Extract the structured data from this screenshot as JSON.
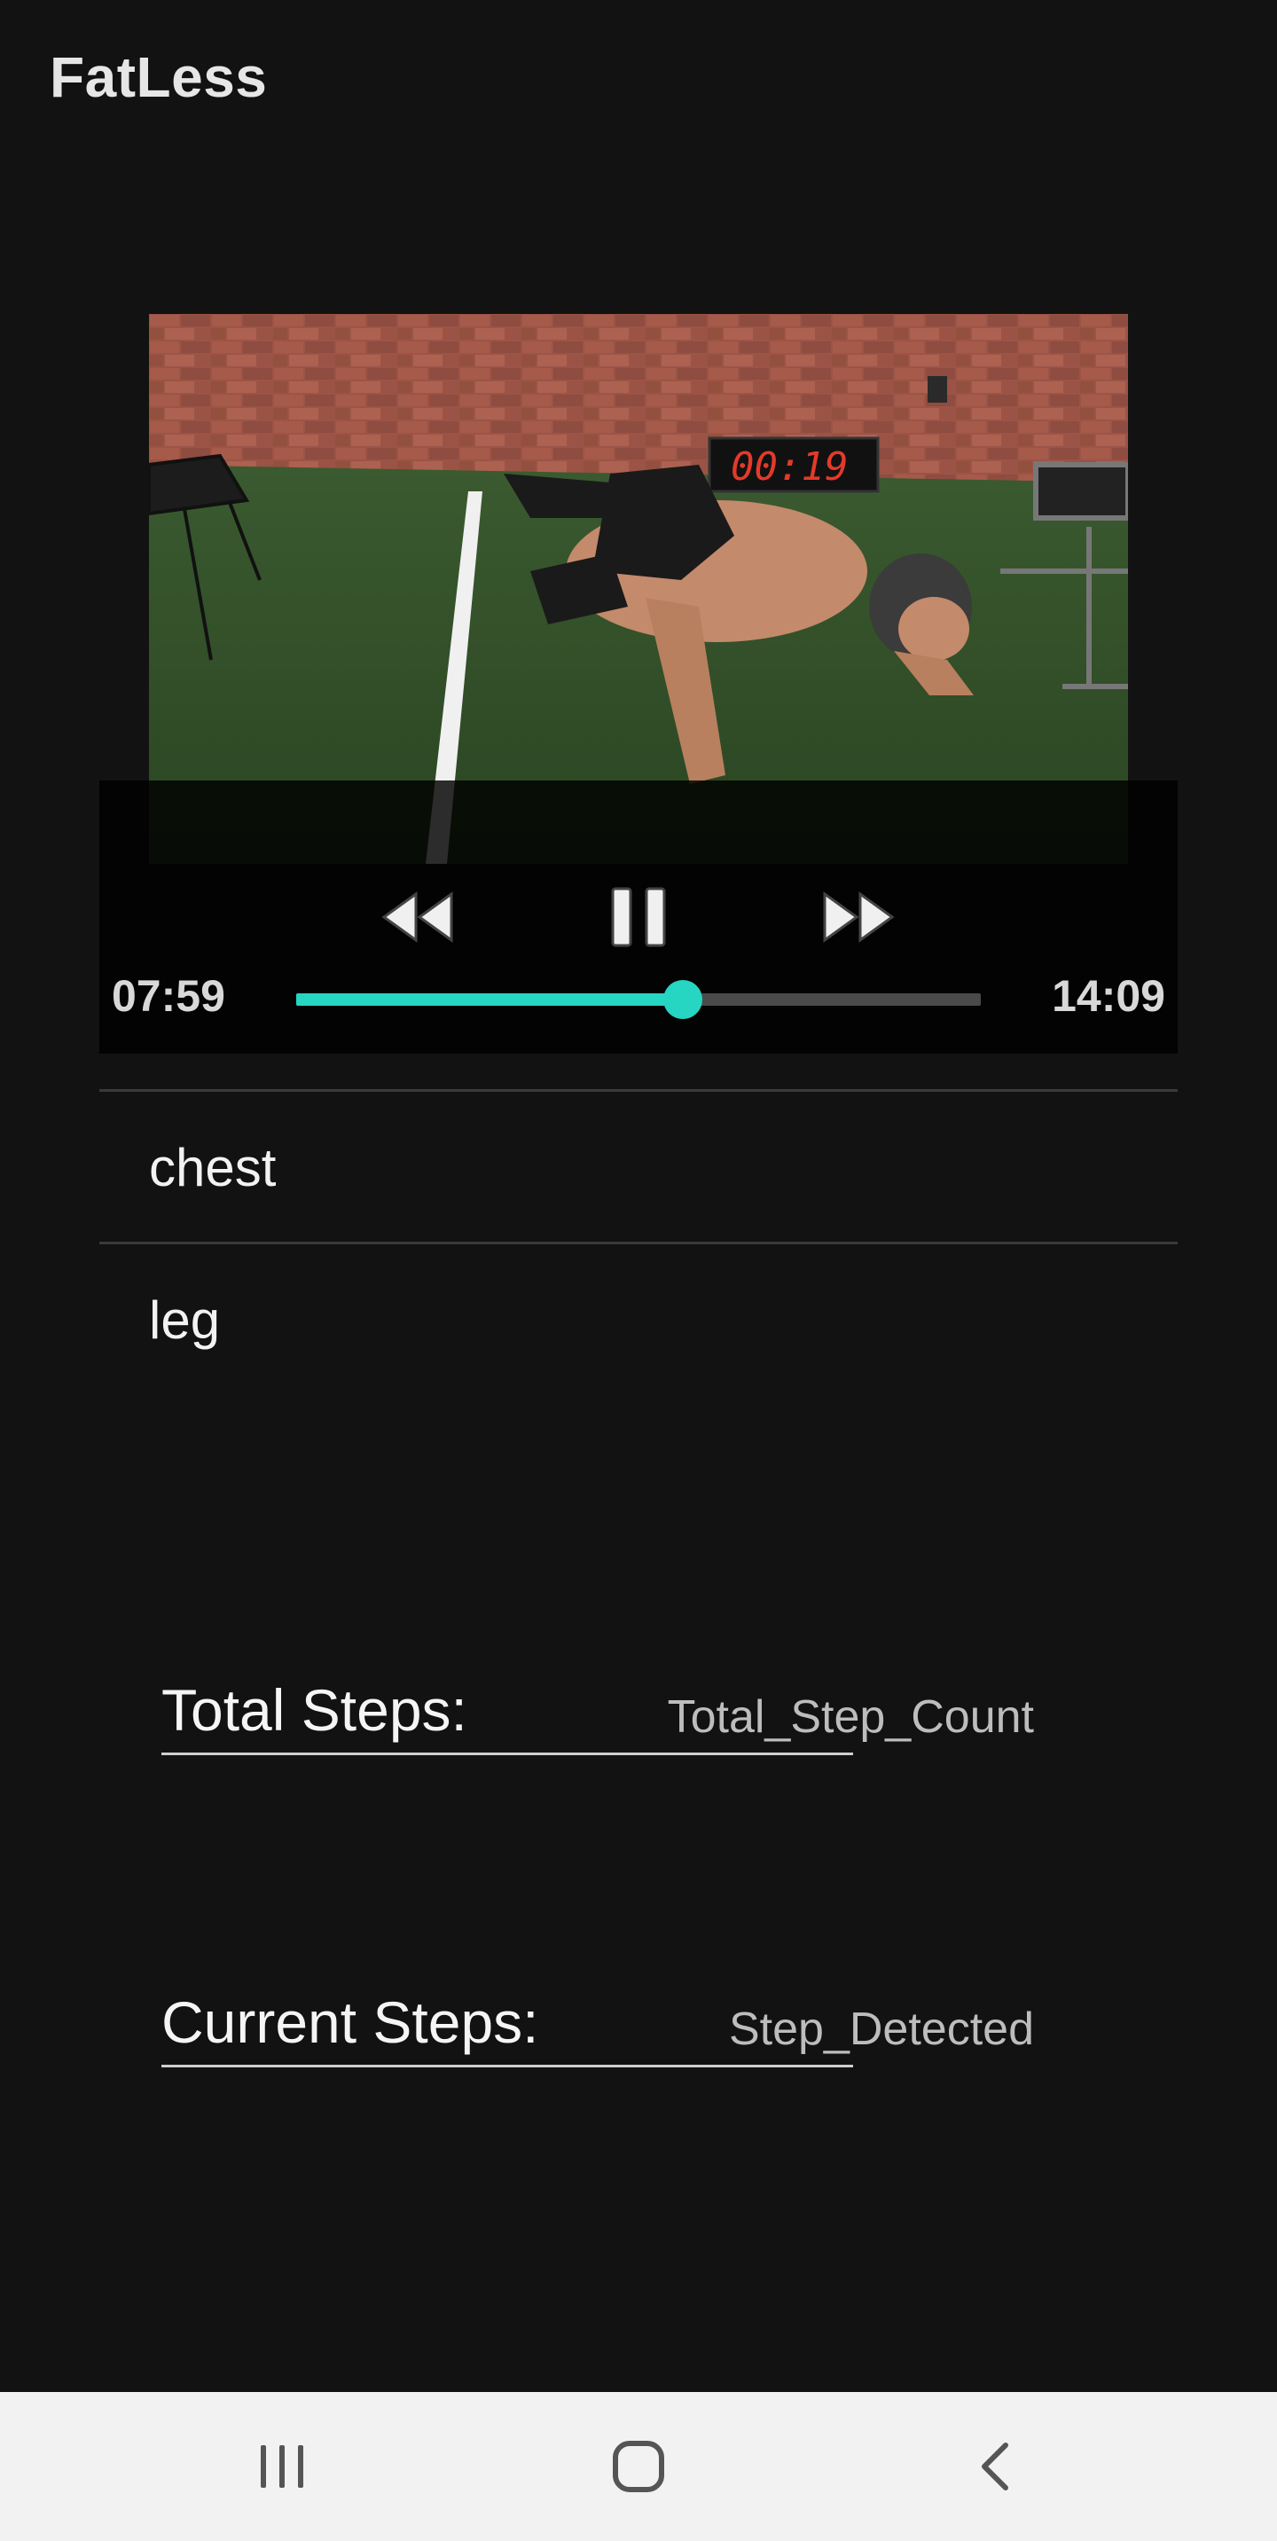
{
  "app": {
    "title": "FatLess"
  },
  "video": {
    "scene": "workout-video-frame",
    "timer_display": "00:19",
    "controls": {
      "rewind_icon": "rewind-icon",
      "pause_icon": "pause-icon",
      "fast_forward_icon": "fast-forward-icon"
    },
    "current_time": "07:59",
    "total_time": "14:09",
    "progress": 0.565,
    "accent_color": "#26d6c2"
  },
  "list": {
    "items": [
      {
        "label": "chest"
      },
      {
        "label": "leg"
      }
    ]
  },
  "steps": {
    "total_label": "Total Steps:",
    "total_value": "Total_Step_Count",
    "current_label": "Current Steps:",
    "current_value": "Step_Detected"
  },
  "nav": {
    "recents_icon": "recents-icon",
    "home_icon": "home-icon",
    "back_icon": "back-icon"
  }
}
